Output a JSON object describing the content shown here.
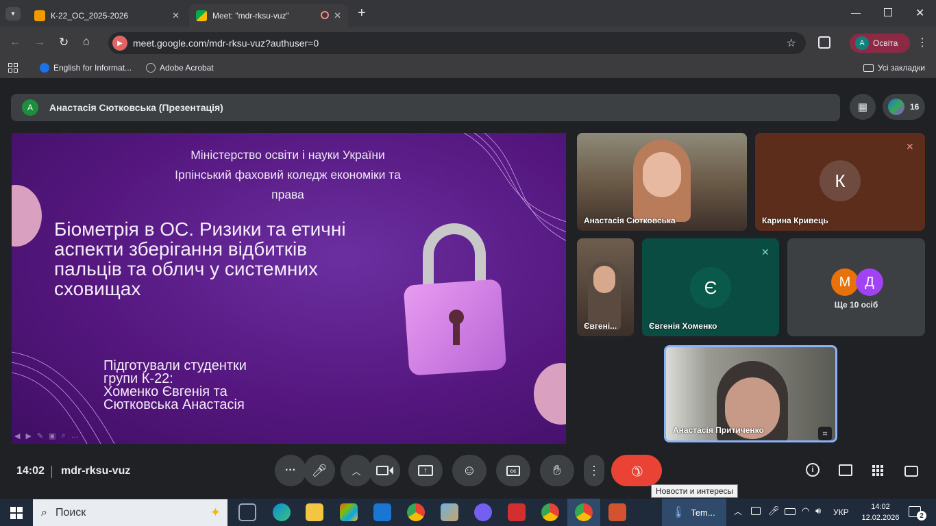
{
  "browser": {
    "tabs": [
      {
        "title": "К-22_ОС_2025-2026",
        "close": "✕"
      },
      {
        "title": "Meet: \"mdr-rksu-vuz\"",
        "close": "✕"
      }
    ],
    "new_tab": "+",
    "url": "meet.google.com/mdr-rksu-vuz?authuser=0",
    "profile_initial": "A",
    "profile_label": "Освіта",
    "bookmarks": [
      {
        "label": "English for Informat..."
      },
      {
        "label": "Adobe Acrobat"
      }
    ],
    "all_bookmarks": "Усі закладки"
  },
  "meet": {
    "presenter_initial": "A",
    "presenter_label": "Анастасія Сютковська (Презентація)",
    "participant_count": "16",
    "slide": {
      "header_lines": [
        "Міністерство освіти і науки України",
        "Ірпінський фаховий коледж економіки та",
        "права"
      ],
      "title_lines": [
        "Біометрія в ОС. Ризики та етичні",
        "аспекти зберігання відбитків",
        "пальців та облич у системних",
        "сховищах"
      ],
      "authors_lines": [
        "Підготували студентки",
        "групи К-22:",
        "Хоменко Євгенія та",
        "Сютковська Анастасія"
      ]
    },
    "tiles": [
      {
        "name": "Анастасія Сютковська"
      },
      {
        "name": "Карина Кривець",
        "initial": "К"
      },
      {
        "name": "Євгені..."
      },
      {
        "name": "Євгенія Хоменко",
        "initial": "Є"
      },
      {
        "more_label": "Ще 10 осіб",
        "initials": [
          "М",
          "Д"
        ]
      },
      {
        "name": "Анастасія Притиченко"
      }
    ],
    "time": "14:02",
    "meeting_code": "mdr-rksu-vuz",
    "tooltip": "Новости и интересы"
  },
  "taskbar": {
    "search_placeholder": "Поиск",
    "weather_label": "Tem...",
    "language": "УКР",
    "clock_time": "14:02",
    "clock_date": "12.02.2026",
    "notification_count": "2"
  },
  "colors": {
    "slide_bg": "#5a1a85",
    "hangup": "#ea4335",
    "accent_green": "#1e8e3e",
    "active_tile_border": "#8ab4f8"
  }
}
